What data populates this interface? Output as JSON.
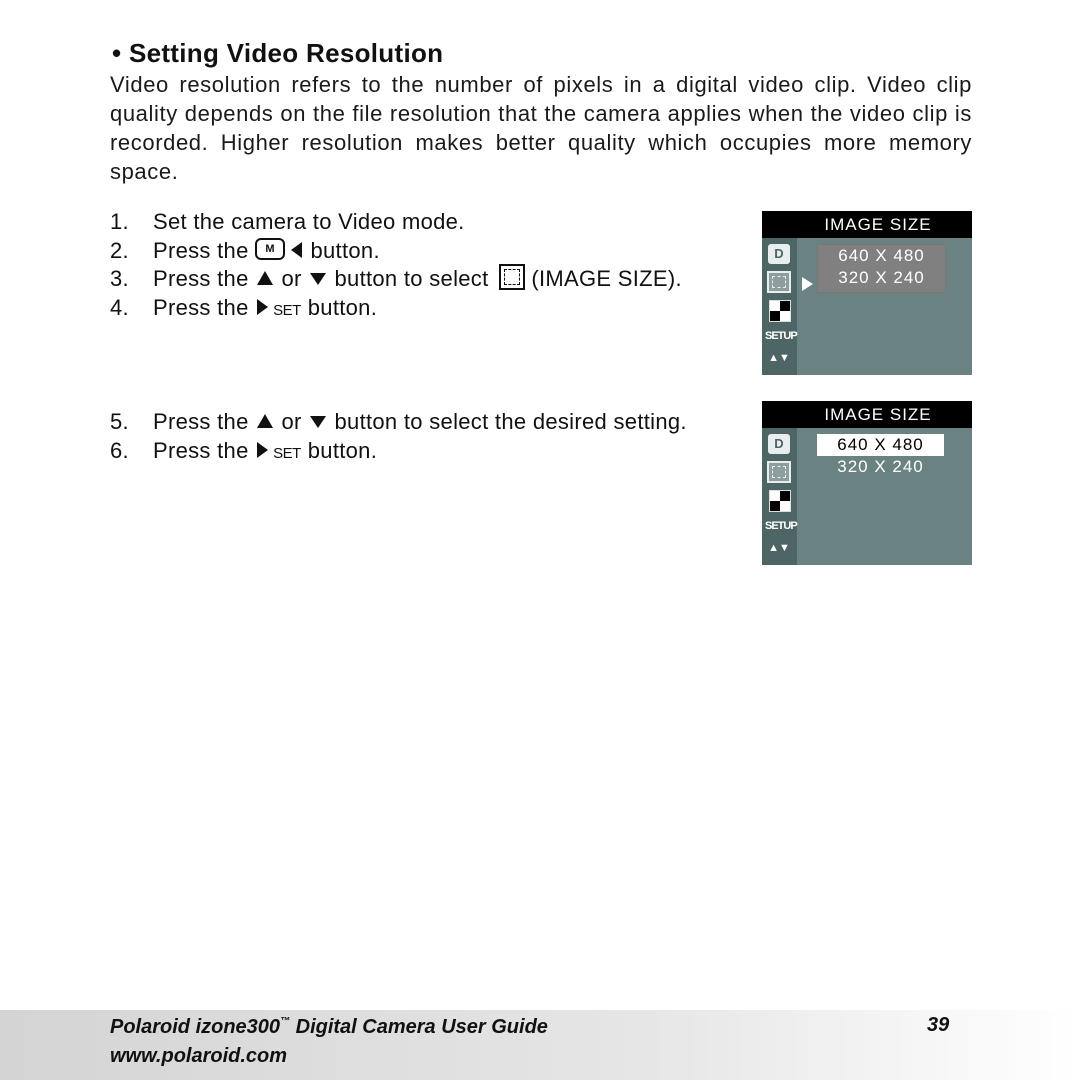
{
  "section": {
    "bullet": "•",
    "title": "Setting Video Resolution",
    "intro": "Video resolution refers to the number of pixels in a digital video clip. Video clip quality depends on the file resolution that the camera applies when the video clip is recorded. Higher resolution makes better quality which occupies more memory space."
  },
  "steps_group1": [
    {
      "num": "1.",
      "text": "Set the camera to Video mode."
    },
    {
      "num": "2.",
      "pre": "Press the",
      "post": "button.",
      "icons": [
        "menu-m-button-icon",
        "left-arrow-icon"
      ]
    },
    {
      "num": "3.",
      "pre": "Press the",
      "mid1": "or",
      "mid2": "button to select",
      "post": "(IMAGE SIZE).",
      "icons": [
        "up-arrow-icon",
        "down-arrow-icon",
        "image-size-icon"
      ]
    },
    {
      "num": "4.",
      "pre": "Press the",
      "set": "SET",
      "post": "button.",
      "icons": [
        "right-arrow-icon"
      ]
    }
  ],
  "steps_group2": [
    {
      "num": "5.",
      "pre": "Press the",
      "mid1": "or",
      "post": "button to select the desired setting.",
      "icons": [
        "up-arrow-icon",
        "down-arrow-icon"
      ]
    },
    {
      "num": "6.",
      "pre": "Press the",
      "set": "SET",
      "post": "button.",
      "icons": [
        "right-arrow-icon"
      ]
    }
  ],
  "menu_key_label": "M",
  "screens": [
    {
      "title": "IMAGE SIZE",
      "side_icons": [
        "D",
        "image-size",
        "quality",
        "SETUP",
        "▲▼"
      ],
      "options": [
        "640 X 480",
        "320 X 240"
      ],
      "selected": null,
      "pointer_on": "image-size"
    },
    {
      "title": "IMAGE SIZE",
      "side_icons": [
        "D",
        "image-size",
        "quality",
        "SETUP",
        "▲▼"
      ],
      "options": [
        "640 X 480",
        "320 X 240"
      ],
      "selected": "640 X 480"
    }
  ],
  "footer": {
    "title": "Polaroid izone300",
    "trademark": "™",
    "title_rest": " Digital Camera User Guide",
    "url": "www.polaroid.com",
    "page": "39"
  }
}
